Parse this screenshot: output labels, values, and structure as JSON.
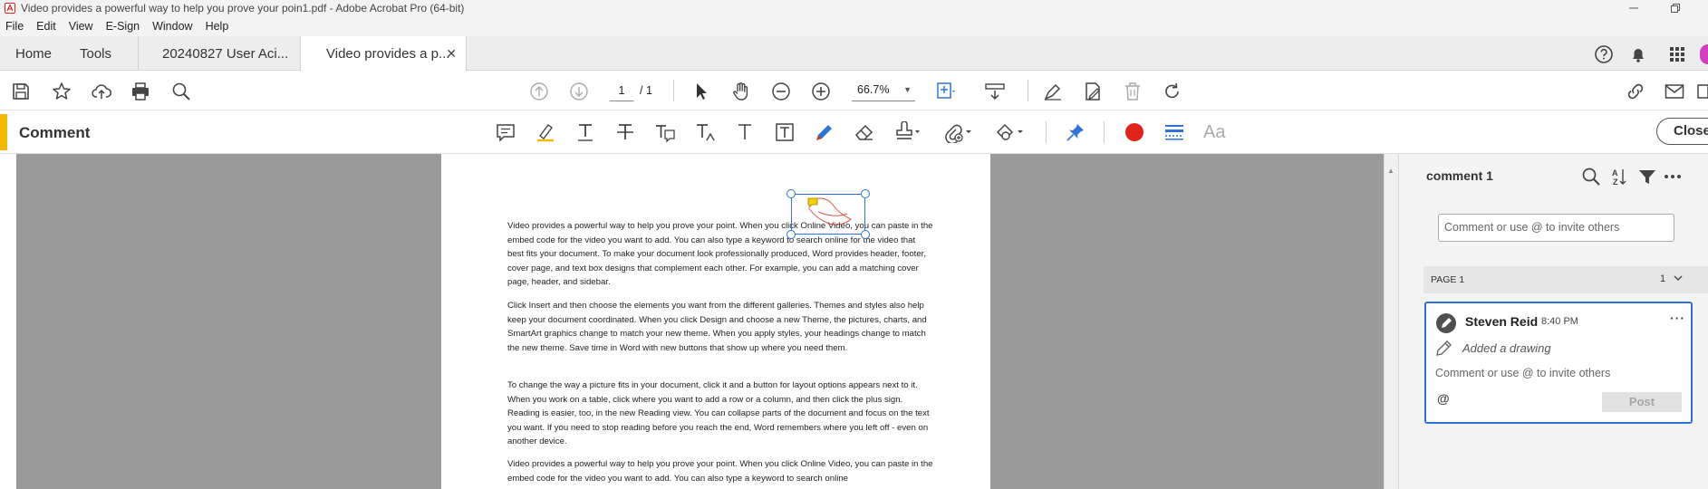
{
  "window": {
    "title": "Video provides a powerful way to help you prove your poin1.pdf - Adobe Acrobat Pro (64-bit)"
  },
  "menu": [
    "File",
    "Edit",
    "View",
    "E-Sign",
    "Window",
    "Help"
  ],
  "tabs": {
    "home": "Home",
    "tools": "Tools",
    "doc1": "20240827 User Aci...",
    "doc2": "Video provides a p...",
    "close_glyph": "✕"
  },
  "toolbar": {
    "page_current": "1",
    "page_total": "/ 1",
    "zoom": "66.7%"
  },
  "comment_toolbar": {
    "label": "Comment",
    "text_glyph": "Aa",
    "close": "Close"
  },
  "document": {
    "paragraphs": [
      "Video provides a powerful way to help you prove your point. When you click Online Video, you can paste in the embed code for the video you want to add. You can also type a keyword to search online for the video that best fits your document. To make your document look professionally produced, Word provides header, footer, cover page, and text box designs that complement each other. For example, you can add a matching cover page, header, and sidebar.",
      "Click Insert and then choose the elements you want from the different galleries. Themes and styles also help keep your document coordinated. When you click Design and choose a new Theme, the pictures, charts, and SmartArt graphics change to match your new theme. When you apply styles, your headings change to match the new theme. Save time in Word with new buttons that show up where you need them.",
      "To change the way a picture fits in your document, click it and a button for layout options appears next to it. When you work on a table, click where you want to add a row or a column, and then click the plus sign. Reading is easier, too, in the new Reading view. You can collapse parts of the document and focus on the text you want. If you need to stop reading before you reach the end, Word remembers where you left off - even on another device.",
      "Video provides a powerful way to help you prove your point. When you click Online Video, you can paste in the embed code for the video you want to add. You can also type a keyword to search online"
    ]
  },
  "comment_pane": {
    "title": "comment 1",
    "input_placeholder": "Comment or use @ to invite others",
    "page_label": "PAGE 1",
    "page_count": "1",
    "card": {
      "author": "Steven Reid",
      "time": "8:40 PM",
      "action": "Added a drawing",
      "reply_placeholder": "Comment or use @ to invite others",
      "at": "@",
      "post": "Post",
      "more": "···"
    }
  },
  "colors": {
    "accent_blue": "#2f72d8",
    "comment_accent": "#f5b800",
    "record_red": "#e0241b",
    "acrobat_red": "#e0241b"
  }
}
